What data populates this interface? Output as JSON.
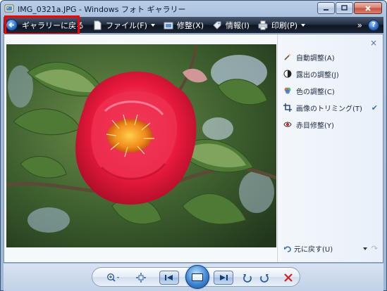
{
  "window": {
    "title": "IMG_0321a.JPG - Windows フォト ギャラリー",
    "controls": {
      "minimize": "minimize",
      "maximize": "maximize",
      "close": "close"
    }
  },
  "toolbar": {
    "back_label": "ギャラリーに戻る",
    "file_label": "ファイル(F)",
    "fix_label": "修整(X)",
    "info_label": "情報(I)",
    "print_label": "印刷(P)",
    "more_label": "»",
    "help_label": "?"
  },
  "fix_panel": {
    "close_label": "×",
    "items": [
      {
        "label": "自動調整(A)",
        "icon": "wand-icon"
      },
      {
        "label": "露出の調整(J)",
        "icon": "exposure-icon"
      },
      {
        "label": "色の調整(C)",
        "icon": "color-icon"
      },
      {
        "label": "画像のトリミング(T)",
        "icon": "crop-icon",
        "checked": true
      },
      {
        "label": "赤目修整(Y)",
        "icon": "redeye-icon"
      }
    ],
    "check_mark": "✔",
    "undo_label": "元に戻す(U)"
  },
  "colors": {
    "toolbar_dark": "#1b2535",
    "highlight": "#ff0000",
    "panel_bg": "#eef3fa",
    "camellia_red": "#e8193c",
    "delete_red": "#d62020"
  },
  "image": {
    "subject": "camellia"
  }
}
